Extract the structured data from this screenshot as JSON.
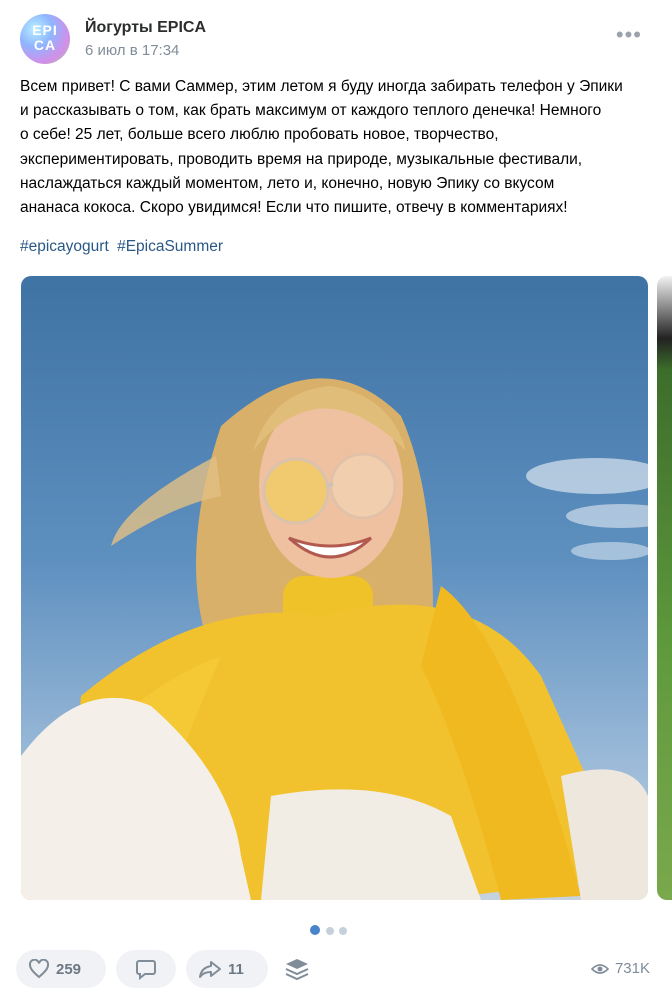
{
  "post": {
    "community_name": "Йогурты EPICA",
    "avatar_text_top": "EPI",
    "avatar_text_bottom": "CA",
    "timestamp": "6 июл в 17:34",
    "more_label": "•••",
    "text_lines": [
      "Всем привет! С вами Саммер, этим летом я буду иногда забирать телефон у Эпики",
      "и рассказывать о том, как брать максимум от каждого теплого денечка! Немного",
      "о себе! 25 лет, больше всего люблю пробовать новое, творчество,",
      "экспериментировать, проводить время на природе, музыкальные фестивали,",
      "наслаждаться каждый моментом, лето и, конечно, новую Эпику со вкусом",
      "ананаса кокоса. Скоро увидимся! Если что пишите, отвечу в комментариях!"
    ],
    "hashtags": [
      "#epicayogurt",
      "#EpicaSummer"
    ]
  },
  "gallery": {
    "total": 3,
    "active_index": 0
  },
  "actions": {
    "likes_count": "259",
    "reposts_count": "11",
    "views_count": "731K"
  },
  "colors": {
    "link": "#2a5885",
    "muted": "#818c99",
    "pill_bg": "#f0f2f5",
    "active_dot": "#4a84c8"
  }
}
